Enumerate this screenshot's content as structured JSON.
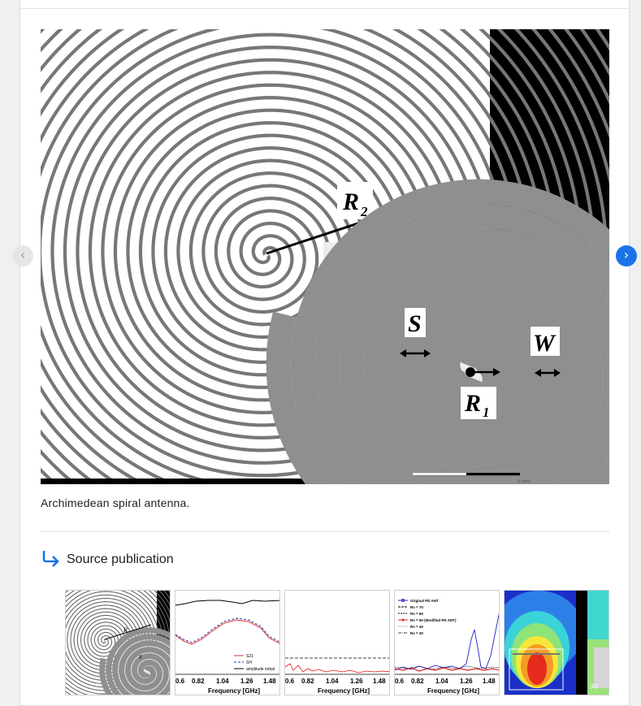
{
  "figure": {
    "labels": {
      "r2": "R",
      "r2_sub": "2",
      "s": "S",
      "w": "W",
      "r1": "R",
      "r1_sub": "1"
    },
    "scale_label": "5 (mm)"
  },
  "caption": "Archimedean spiral antenna.",
  "source": {
    "label": "Source publication",
    "icon": "return-arrow-icon"
  },
  "nav": {
    "prev": "‹",
    "next": "›",
    "next_color": "#1a73e8"
  },
  "thumbnails": [
    {
      "kind": "spiral"
    },
    {
      "kind": "plot",
      "xticks": [
        "0.6",
        "0.82",
        "1.04",
        "1.26",
        "1.48"
      ],
      "xlabel": "Frequency [GHz]",
      "legend": [
        "S21",
        "SH",
        "amplitude imbal"
      ]
    },
    {
      "kind": "plot",
      "xticks": [
        "0.6",
        "0.82",
        "1.04",
        "1.26",
        "1.48"
      ],
      "xlabel": "Frequency [GHz]"
    },
    {
      "kind": "plot",
      "xticks": [
        "0.6",
        "0.82",
        "1.04",
        "1.26",
        "1.48"
      ],
      "xlabel": "Frequency [GHz]",
      "legend": [
        "Original PD ANT",
        "Rs = 70",
        "Rs = 60",
        "Rs = 50 (Modified PD ANT)",
        "Rs = 40",
        "Rs = 30"
      ]
    },
    {
      "kind": "heatmap",
      "label": "(b)"
    }
  ]
}
